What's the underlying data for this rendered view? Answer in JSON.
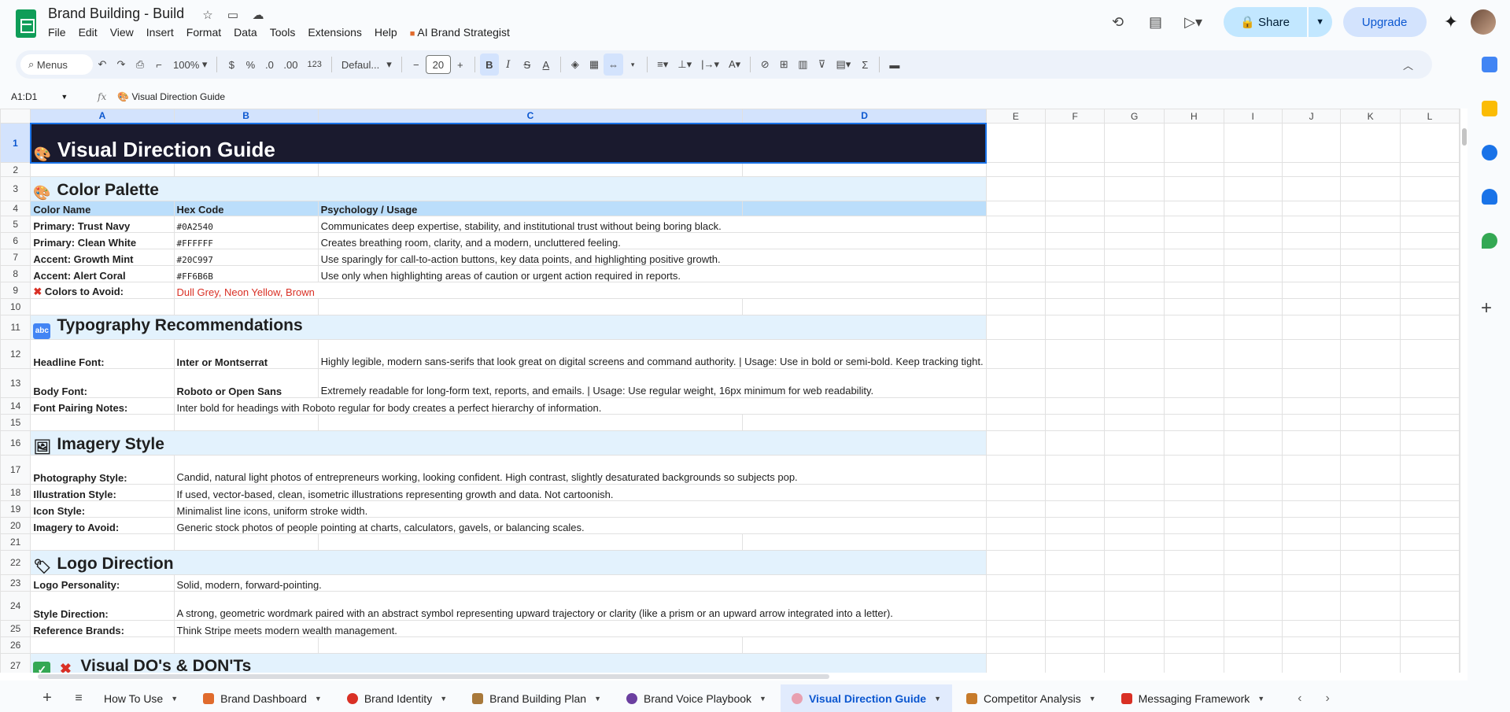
{
  "document": {
    "title": "Brand Building - Build",
    "menus": [
      "File",
      "Edit",
      "View",
      "Insert",
      "Format",
      "Data",
      "Tools",
      "Extensions",
      "Help",
      "AI Brand Strategist"
    ]
  },
  "top_right": {
    "share_label": "Share",
    "upgrade_label": "Upgrade"
  },
  "toolbar": {
    "search_label": "Menus",
    "zoom": "100%",
    "currency": "$",
    "percent": "%",
    "decrease_decimal": ".0",
    "increase_decimal": ".00",
    "number_format": "123",
    "font": "Defaul...",
    "font_size": "20",
    "bold": "B",
    "italic": "I",
    "strike": "S",
    "text_color": "A",
    "sum": "Σ"
  },
  "formula_bar": {
    "name_box": "A1:D1",
    "fx": "fx",
    "content": "🎨 Visual Direction Guide"
  },
  "columns": [
    "A",
    "B",
    "C",
    "D",
    "E",
    "F",
    "G",
    "H",
    "I",
    "J",
    "K",
    "L"
  ],
  "rows": {
    "r1": {
      "n": "1",
      "title": "Visual Direction Guide"
    },
    "r2": {
      "n": "2"
    },
    "r3": {
      "n": "3",
      "title": "Color Palette"
    },
    "r4": {
      "n": "4",
      "a": "Color Name",
      "b": "Hex Code",
      "c": "Psychology / Usage"
    },
    "r5": {
      "n": "5",
      "a": "Primary: Trust Navy",
      "b": "#0A2540",
      "c": "Communicates deep expertise, stability, and institutional trust without being boring black."
    },
    "r6": {
      "n": "6",
      "a": "Primary: Clean White",
      "b": "#FFFFFF",
      "c": "Creates breathing room, clarity, and a modern, uncluttered feeling."
    },
    "r7": {
      "n": "7",
      "a": "Accent: Growth Mint",
      "b": "#20C997",
      "c": "Use sparingly for call-to-action buttons, key data points, and highlighting positive growth."
    },
    "r8": {
      "n": "8",
      "a": "Accent: Alert Coral",
      "b": "#FF6B6B",
      "c": "Use only when highlighting areas of caution or urgent action required in reports."
    },
    "r9": {
      "n": "9",
      "a": "Colors to Avoid:",
      "b": "Dull Grey, Neon Yellow, Brown"
    },
    "r10": {
      "n": "10"
    },
    "r11": {
      "n": "11",
      "title": "Typography Recommendations"
    },
    "r12": {
      "n": "12",
      "a": "Headline Font:",
      "b": "Inter or Montserrat",
      "c": "Highly legible, modern sans-serifs that look great on digital screens and command authority. | Usage: Use in bold or semi-bold. Keep tracking tight."
    },
    "r13": {
      "n": "13",
      "a": "Body Font:",
      "b": "Roboto or Open Sans",
      "c": "Extremely readable for long-form text, reports, and emails. | Usage: Use regular weight, 16px minimum for web readability."
    },
    "r14": {
      "n": "14",
      "a": "Font Pairing Notes:",
      "b": "Inter bold for headings with Roboto regular for body creates a perfect hierarchy of information."
    },
    "r15": {
      "n": "15"
    },
    "r16": {
      "n": "16",
      "title": "Imagery Style"
    },
    "r17": {
      "n": "17",
      "a": "Photography Style:",
      "b": "Candid, natural light photos of entrepreneurs working, looking confident. High contrast, slightly desaturated backgrounds so subjects pop."
    },
    "r18": {
      "n": "18",
      "a": "Illustration Style:",
      "b": "If used, vector-based, clean, isometric illustrations representing growth and data. Not cartoonish."
    },
    "r19": {
      "n": "19",
      "a": "Icon Style:",
      "b": "Minimalist line icons, uniform stroke width."
    },
    "r20": {
      "n": "20",
      "a": "Imagery to Avoid:",
      "b": "Generic stock photos of people pointing at charts, calculators, gavels, or balancing scales."
    },
    "r21": {
      "n": "21"
    },
    "r22": {
      "n": "22",
      "title": "Logo Direction"
    },
    "r23": {
      "n": "23",
      "a": "Logo Personality:",
      "b": "Solid, modern, forward-pointing."
    },
    "r24": {
      "n": "24",
      "a": "Style Direction:",
      "b": "A strong, geometric wordmark paired with an abstract symbol representing upward trajectory or clarity (like a prism or an upward arrow integrated into a letter)."
    },
    "r25": {
      "n": "25",
      "a": "Reference Brands:",
      "b": "Think Stripe meets modern wealth management."
    },
    "r26": {
      "n": "26"
    },
    "r27": {
      "n": "27",
      "title": "Visual DO's & DON'Ts"
    }
  },
  "sheet_tabs": [
    {
      "label": "How To Use",
      "color": ""
    },
    {
      "label": "Brand Dashboard",
      "color": "#e06b2d"
    },
    {
      "label": "Brand Identity",
      "color": "#d93025"
    },
    {
      "label": "Brand Building Plan",
      "color": "#a8793b"
    },
    {
      "label": "Brand Voice Playbook",
      "color": "#6b3fa0"
    },
    {
      "label": "Visual Direction Guide",
      "color": "#e8a0b0"
    },
    {
      "label": "Competitor Analysis",
      "color": "#c77b2b"
    },
    {
      "label": "Messaging Framework",
      "color": "#d93025"
    }
  ],
  "colors": {
    "hero_bg": "#1a1a2e",
    "section_bg": "#e3f2fd",
    "header_bg": "#bbdefb",
    "avoid_text": "#d93025",
    "accent_blue": "#0b57d0"
  }
}
